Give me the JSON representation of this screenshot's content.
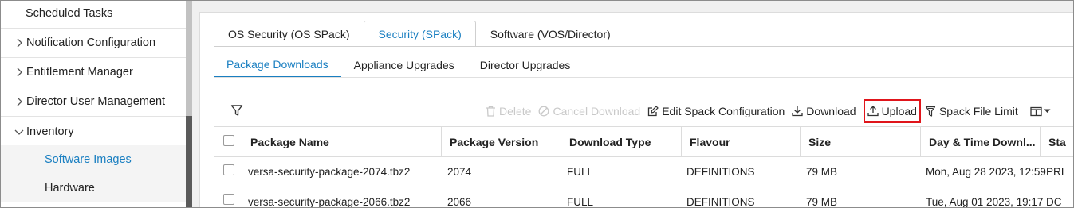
{
  "sidebar": {
    "items": [
      {
        "label": "Scheduled Tasks",
        "has_chevron": false,
        "expanded": false
      },
      {
        "label": "Notification Configuration",
        "has_chevron": true,
        "expanded": false
      },
      {
        "label": "Entitlement Manager",
        "has_chevron": true,
        "expanded": false
      },
      {
        "label": "Director User Management",
        "has_chevron": true,
        "expanded": false
      },
      {
        "label": "Inventory",
        "has_chevron": true,
        "expanded": true
      }
    ],
    "sub_items": [
      {
        "label": "Software Images",
        "active": true
      },
      {
        "label": "Hardware",
        "active": false
      }
    ]
  },
  "tabs": {
    "primary": [
      {
        "label": "OS Security (OS SPack)",
        "active": false
      },
      {
        "label": "Security (SPack)",
        "active": true
      },
      {
        "label": "Software (VOS/Director)",
        "active": false
      }
    ],
    "secondary": [
      {
        "label": "Package Downloads",
        "active": true
      },
      {
        "label": "Appliance Upgrades",
        "active": false
      },
      {
        "label": "Director Upgrades",
        "active": false
      }
    ]
  },
  "toolbar": {
    "filter_icon": "filter-icon",
    "delete_label": "Delete",
    "cancel_download_label": "Cancel Download",
    "edit_config_label": "Edit Spack Configuration",
    "download_label": "Download",
    "upload_label": "Upload",
    "file_limit_label": "Spack File Limit",
    "column_picker_icon": "columns-icon"
  },
  "table": {
    "columns": [
      "Package Name",
      "Package Version",
      "Download Type",
      "Flavour",
      "Size",
      "Day & Time Downl...",
      "Sta"
    ],
    "rows": [
      [
        "versa-security-package-2074.tbz2",
        "2074",
        "FULL",
        "DEFINITIONS",
        "79 MB",
        "Mon, Aug 28 2023, 12:59",
        "PRI"
      ],
      [
        "versa-security-package-2066.tbz2",
        "2066",
        "FULL",
        "DEFINITIONS",
        "79 MB",
        "Tue, Aug 01 2023, 19:17",
        "DC"
      ]
    ]
  },
  "colors": {
    "accent": "#1a7fc1",
    "highlight_box": "#e0151b",
    "disabled_text": "#c9c9c9"
  }
}
